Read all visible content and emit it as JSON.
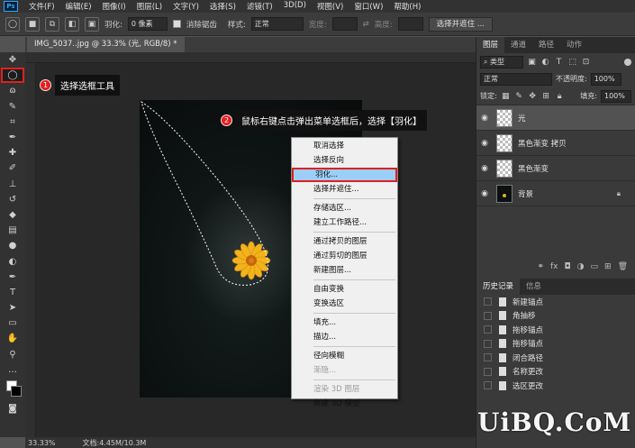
{
  "menubar": {
    "logo": "Ps",
    "items": [
      "文件(F)",
      "编辑(E)",
      "图像(I)",
      "图层(L)",
      "文字(Y)",
      "选择(S)",
      "滤镜(T)",
      "3D(D)",
      "视图(V)",
      "窗口(W)",
      "帮助(H)"
    ]
  },
  "options": {
    "feather_label": "羽化:",
    "feather_value": "0 像素",
    "antialias_label": "消除锯齿",
    "style_label": "样式:",
    "style_value": "正常",
    "width_label": "宽度:",
    "height_label": "高度:",
    "select_mask_button": "选择并遮住 ..."
  },
  "document": {
    "tab_title": "IMG_5037..jpg @ 33.3% (光, RGB/8) *",
    "zoom": "33.33%",
    "doc_size": "文档:4.45M/10.3M"
  },
  "callouts": {
    "step1_num": "1",
    "step1_text": "选择选框工具",
    "step2_num": "2",
    "step2_text": "鼠标右键点击弹出菜单选框后，选择【羽化】"
  },
  "context_menu": {
    "items": [
      {
        "label": "取消选择",
        "disabled": false
      },
      {
        "label": "选择反向",
        "disabled": false
      },
      {
        "label": "羽化...",
        "disabled": false,
        "highlighted": true
      },
      {
        "label": "选择并遮住...",
        "disabled": false
      },
      {
        "sep": true
      },
      {
        "label": "存储选区...",
        "disabled": false
      },
      {
        "label": "建立工作路径...",
        "disabled": false
      },
      {
        "sep": true
      },
      {
        "label": "通过拷贝的图层",
        "disabled": false
      },
      {
        "label": "通过剪切的图层",
        "disabled": false
      },
      {
        "label": "新建图层...",
        "disabled": false
      },
      {
        "sep": true
      },
      {
        "label": "自由变换",
        "disabled": false
      },
      {
        "label": "变换选区",
        "disabled": false
      },
      {
        "sep": true
      },
      {
        "label": "填充...",
        "disabled": false
      },
      {
        "label": "描边...",
        "disabled": false
      },
      {
        "sep": true
      },
      {
        "label": "径向模糊",
        "disabled": false
      },
      {
        "label": "渐隐...",
        "disabled": true
      },
      {
        "sep": true
      },
      {
        "label": "渲染 3D 图层",
        "disabled": true
      },
      {
        "label": "新建 3D 模型",
        "disabled": false
      }
    ]
  },
  "layers_panel": {
    "tabs": [
      "图层",
      "通道",
      "路径",
      "动作"
    ],
    "filter_kind": "类型",
    "blend_mode": "正常",
    "opacity_label": "不透明度:",
    "opacity_value": "100%",
    "lock_label": "锁定:",
    "fill_label": "填充:",
    "fill_value": "100%",
    "layers": [
      {
        "name": "光",
        "thumb": "checker",
        "selected": true,
        "locked": false
      },
      {
        "name": "黑色渐变 拷贝",
        "thumb": "checker",
        "selected": false,
        "locked": false
      },
      {
        "name": "黑色渐变",
        "thumb": "checker",
        "selected": false,
        "locked": false
      },
      {
        "name": "背景",
        "thumb": "dark",
        "selected": false,
        "locked": true
      }
    ]
  },
  "history_panel": {
    "tabs": [
      "历史记录",
      "信息"
    ],
    "items": [
      "新建锚点",
      "角抽移",
      "拖移锚点",
      "拖移锚点",
      "闭合路径",
      "名称更改",
      "选区更改"
    ]
  },
  "watermark": "UiBQ.CoM"
}
